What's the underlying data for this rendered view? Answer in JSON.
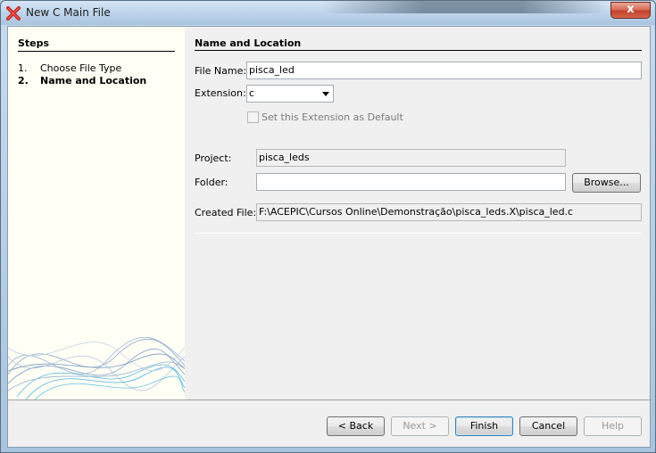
{
  "window": {
    "title": "New C Main File",
    "close_label": "x"
  },
  "steps": {
    "title": "Steps",
    "items": [
      {
        "num": "1.",
        "label": "Choose File Type"
      },
      {
        "num": "2.",
        "label": "Name and Location"
      }
    ]
  },
  "main": {
    "title": "Name and Location",
    "file_name": {
      "label": "File Name:",
      "value": "pisca_led"
    },
    "extension": {
      "label": "Extension:",
      "value": "c"
    },
    "default_ext": {
      "label": "Set this Extension as Default"
    },
    "project": {
      "label": "Project:",
      "value": "pisca_leds"
    },
    "folder": {
      "label": "Folder:",
      "value": "",
      "browse": "Browse..."
    },
    "created_file": {
      "label": "Created File:",
      "value": "F:\\ACEPIC\\Cursos Online\\Demonstração\\pisca_leds.X\\pisca_led.c"
    }
  },
  "buttons": {
    "back": "< Back",
    "next": "Next >",
    "finish": "Finish",
    "cancel": "Cancel",
    "help": "Help"
  }
}
